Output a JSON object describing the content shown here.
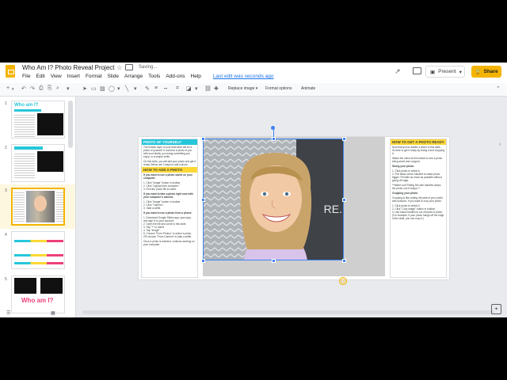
{
  "app": {
    "title": "Who Am I? Photo Reveal Project",
    "status": "Saving...",
    "menu": [
      "File",
      "Edit",
      "View",
      "Insert",
      "Format",
      "Slide",
      "Arrange",
      "Tools",
      "Add-ons",
      "Help"
    ],
    "last_edit": "Last edit was seconds ago",
    "present_label": "Present",
    "share_label": "Share"
  },
  "toolbar": {
    "replace_image": "Replace image",
    "format_options": "Format options",
    "animate": "Animate"
  },
  "filmstrip": {
    "slides": [
      {
        "num": "1",
        "title": "Who am I?",
        "caption": "Photo Reveal Project"
      },
      {
        "num": "2",
        "title": "HOW TO REVEAL YOUR SLIDE?"
      },
      {
        "num": "3"
      },
      {
        "num": "4"
      },
      {
        "num": "5",
        "title": "Who am I?"
      }
    ],
    "selected": 3
  },
  "slide": {
    "left": {
      "h1": "PHOTO OF YOURSELF",
      "p1": "The bottom layer of your final slide will be a photo of yourself. It could be a photo of you with your family, you doing something you enjoy, or a simple selfie.",
      "p2": "On this slide, you will add your photo and get it ready. Below are 3 ways to add a photo.",
      "h2": "HOW TO ADD A PHOTO",
      "s1": "If you want to use a photo saved on your computer:",
      "s1_steps": [
        "Click \"Image\" button in toolbar.",
        "Click \"Upload from computer.\"",
        "Find the photo file to insert."
      ],
      "s2": "If you want to take a photo right now with your computer's camera:",
      "s2_steps": [
        "Click \"Image\" button in toolbar.",
        "Click \"Camera.\"",
        "Take a selfie."
      ],
      "s3": "If you want to use a photo from a phone:",
      "s3_steps": [
        "Download Google Slides app, open app, and sign in to your account.",
        "Open the file and come to this slide.",
        "Tap \"+\" to insert.",
        "Tap \"Image\".",
        "Choose \"From Photos\" to select a photo, OR choose \"From Camera\" to take a selfie."
      ],
      "p3": "Once a photo is inserted, continue working on your computer."
    },
    "right": {
      "h1": "HOW TO GET A PHOTO READY",
      "p1": "Now that you've added a photo to this slide, it's time to get it ready by sizing it and cropping it.",
      "p2": "Watch the video at the bottom to see a photo being sized and cropped.",
      "s1": "Sizing your photo:",
      "s1_steps": [
        "Click photo to select it.",
        "Pull black corner handles to make photo bigger. Fill slide as much as possible without going off edge."
      ],
      "note": "**Watch out! Pulling the side handles warps the photo out of shape.**",
      "s2": "Cropping your photo:",
      "p3": "Cropping is like cutting off parts of your photo with scissors. If you want to crop your photo:",
      "s2_steps": [
        "Click photo to select it.",
        "Click \"Crop image\" button in toolbar.",
        "Use black handles to cut off parts of photo. (For example, if your photo hangs off the edge of the slide, you can crop it.)"
      ]
    },
    "here_text": "RE."
  }
}
